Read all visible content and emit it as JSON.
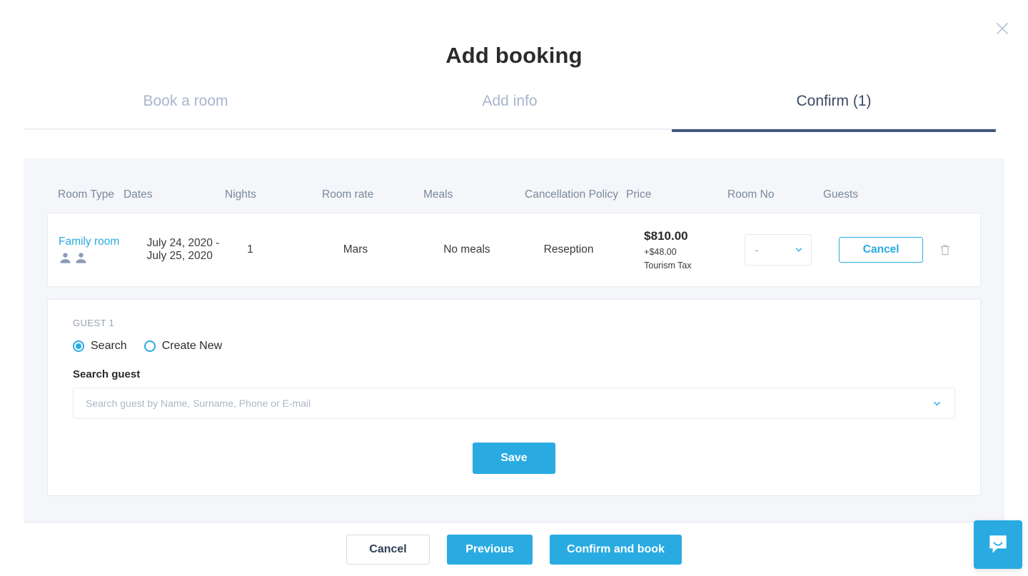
{
  "modal": {
    "title": "Add booking",
    "close_icon": "close-icon"
  },
  "tabs": [
    {
      "label": "Book a room",
      "active": false
    },
    {
      "label": "Add info",
      "active": false
    },
    {
      "label": "Confirm (1)",
      "active": true
    }
  ],
  "booking_table": {
    "columns": [
      "Room Type",
      "Dates",
      "Nights",
      "Room rate",
      "Meals",
      "Cancellation Policy",
      "Price",
      "Room No",
      "Guests"
    ],
    "row": {
      "room_type": "Family room",
      "occupancy_icon": "two-people-icon",
      "dates": "July 24, 2020 - July 25, 2020",
      "nights": "1",
      "room_rate": "Mars",
      "meals": "No meals",
      "cancellation_policy": "Reseption",
      "price": "$810.00",
      "price_extra": "+$48.00",
      "price_extra_label": "Tourism Tax",
      "room_no_value": "-",
      "room_no_icon": "chevron-down-icon",
      "cancel_label": "Cancel",
      "delete_icon": "trash-icon"
    }
  },
  "guest_section": {
    "heading": "GUEST 1",
    "options": [
      {
        "label": "Search",
        "selected": true
      },
      {
        "label": "Create New",
        "selected": false
      }
    ],
    "field_label": "Search guest",
    "search_value": "",
    "search_placeholder": "Search guest by Name, Surname, Phone or E-mail",
    "search_icon": "chevron-down-icon",
    "save_label": "Save"
  },
  "footer": {
    "cancel_label": "Cancel",
    "previous_label": "Previous",
    "confirm_label": "Confirm and book"
  },
  "chat_widget": {
    "icon": "chat-bubble-smile-icon"
  },
  "colors": {
    "accent": "#29abe2",
    "active_tab": "#45597e",
    "tab_inactive": "#a8b6cc",
    "panel_bg": "#f4f6f9",
    "text": "#2b2b2b"
  }
}
